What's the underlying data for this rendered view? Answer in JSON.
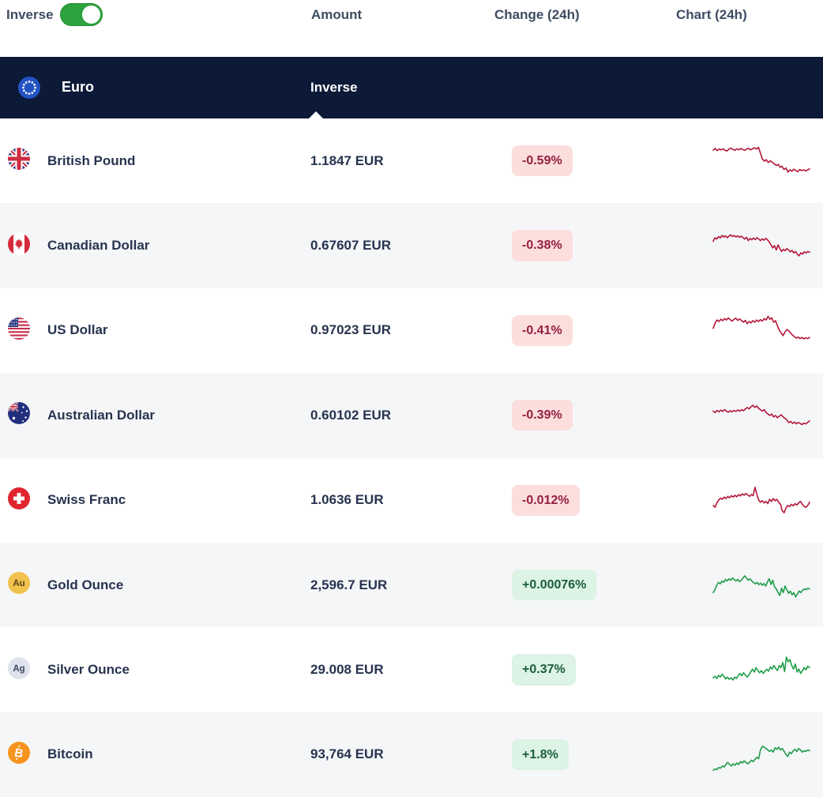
{
  "toolbar": {
    "inverse_label": "Inverse",
    "toggle_on": true,
    "columns": {
      "amount": "Amount",
      "change": "Change (24h)",
      "chart": "Chart (24h)"
    }
  },
  "header": {
    "name": "Euro",
    "inverse_label": "Inverse",
    "flag": "eu"
  },
  "colors": {
    "navy_header": "#0c1a38",
    "toggle_green": "#2da23e",
    "row_alt": "#f5f6f8",
    "badge_down_bg": "#fcdedd",
    "badge_down_text": "#94203f",
    "badge_up_bg": "#dcf3e6",
    "badge_up_text": "#1b5e3a",
    "spark_down": "#b3173a",
    "spark_up": "#1f9d48"
  },
  "table": {
    "rows": [
      {
        "name": "British Pound",
        "flag": "gb",
        "amount": "1.1847 EUR",
        "change": "-0.59%",
        "direction": "down",
        "sparkline": [
          0.8,
          0.85,
          0.79,
          0.83,
          0.81,
          0.84,
          0.8,
          0.78,
          0.83,
          0.86,
          0.82,
          0.8,
          0.84,
          0.81,
          0.85,
          0.82,
          0.8,
          0.83,
          0.85,
          0.81,
          0.84,
          0.87,
          0.83,
          0.88,
          0.72,
          0.56,
          0.5,
          0.54,
          0.46,
          0.51,
          0.47,
          0.43,
          0.38,
          0.41,
          0.33,
          0.36,
          0.27,
          0.31,
          0.2,
          0.26,
          0.22,
          0.28,
          0.24,
          0.21,
          0.27,
          0.24,
          0.26,
          0.23,
          0.26,
          0.29
        ]
      },
      {
        "name": "Canadian Dollar",
        "flag": "ca",
        "amount": "0.67607 EUR",
        "change": "-0.38%",
        "direction": "down",
        "sparkline": [
          0.62,
          0.72,
          0.68,
          0.75,
          0.71,
          0.78,
          0.74,
          0.77,
          0.72,
          0.76,
          0.8,
          0.75,
          0.78,
          0.74,
          0.77,
          0.73,
          0.76,
          0.72,
          0.68,
          0.73,
          0.64,
          0.7,
          0.66,
          0.71,
          0.67,
          0.72,
          0.68,
          0.64,
          0.69,
          0.65,
          0.7,
          0.66,
          0.6,
          0.52,
          0.44,
          0.5,
          0.38,
          0.52,
          0.42,
          0.34,
          0.4,
          0.36,
          0.42,
          0.38,
          0.33,
          0.37,
          0.3,
          0.34,
          0.26,
          0.22,
          0.3,
          0.27,
          0.33,
          0.3,
          0.34,
          0.32
        ]
      },
      {
        "name": "US Dollar",
        "flag": "us",
        "amount": "0.97023 EUR",
        "change": "-0.41%",
        "direction": "down",
        "sparkline": [
          0.55,
          0.7,
          0.78,
          0.74,
          0.8,
          0.76,
          0.82,
          0.78,
          0.84,
          0.79,
          0.75,
          0.8,
          0.83,
          0.77,
          0.81,
          0.76,
          0.72,
          0.77,
          0.68,
          0.74,
          0.7,
          0.76,
          0.72,
          0.78,
          0.74,
          0.79,
          0.75,
          0.82,
          0.78,
          0.88,
          0.8,
          0.84,
          0.72,
          0.76,
          0.62,
          0.5,
          0.42,
          0.35,
          0.45,
          0.52,
          0.48,
          0.42,
          0.36,
          0.32,
          0.28,
          0.31,
          0.27,
          0.3,
          0.26,
          0.29,
          0.27,
          0.3
        ]
      },
      {
        "name": "Australian Dollar",
        "flag": "au",
        "amount": "0.60102 EUR",
        "change": "-0.39%",
        "direction": "down",
        "sparkline": [
          0.62,
          0.58,
          0.64,
          0.6,
          0.65,
          0.61,
          0.66,
          0.62,
          0.59,
          0.63,
          0.6,
          0.64,
          0.61,
          0.65,
          0.62,
          0.66,
          0.63,
          0.68,
          0.72,
          0.68,
          0.74,
          0.78,
          0.72,
          0.76,
          0.7,
          0.66,
          0.62,
          0.66,
          0.58,
          0.54,
          0.5,
          0.54,
          0.46,
          0.5,
          0.44,
          0.48,
          0.52,
          0.46,
          0.42,
          0.38,
          0.3,
          0.34,
          0.28,
          0.32,
          0.27,
          0.31,
          0.28,
          0.25,
          0.29,
          0.27,
          0.31,
          0.35
        ]
      },
      {
        "name": "Swiss Franc",
        "flag": "ch",
        "amount": "1.0636 EUR",
        "change": "-0.012%",
        "direction": "down",
        "sparkline": [
          0.35,
          0.3,
          0.42,
          0.5,
          0.55,
          0.52,
          0.58,
          0.54,
          0.6,
          0.56,
          0.62,
          0.58,
          0.63,
          0.59,
          0.65,
          0.61,
          0.67,
          0.63,
          0.68,
          0.64,
          0.6,
          0.65,
          0.62,
          0.85,
          0.66,
          0.5,
          0.44,
          0.48,
          0.42,
          0.46,
          0.4,
          0.52,
          0.46,
          0.54,
          0.48,
          0.52,
          0.44,
          0.38,
          0.2,
          0.15,
          0.28,
          0.35,
          0.32,
          0.38,
          0.34,
          0.4,
          0.36,
          0.42,
          0.46,
          0.38,
          0.32,
          0.3,
          0.35,
          0.44
        ]
      },
      {
        "name": "Gold Ounce",
        "flag": "gold",
        "amount": "2,596.7 EUR",
        "change": "+0.00076%",
        "direction": "up",
        "sparkline": [
          0.3,
          0.38,
          0.5,
          0.58,
          0.54,
          0.62,
          0.58,
          0.66,
          0.62,
          0.68,
          0.64,
          0.7,
          0.66,
          0.62,
          0.66,
          0.6,
          0.64,
          0.7,
          0.76,
          0.7,
          0.64,
          0.68,
          0.62,
          0.58,
          0.54,
          0.58,
          0.52,
          0.56,
          0.5,
          0.55,
          0.48,
          0.6,
          0.68,
          0.52,
          0.64,
          0.46,
          0.4,
          0.3,
          0.22,
          0.42,
          0.3,
          0.48,
          0.38,
          0.28,
          0.34,
          0.24,
          0.3,
          0.18,
          0.26,
          0.34,
          0.3,
          0.36,
          0.4,
          0.38,
          0.42,
          0.4
        ]
      },
      {
        "name": "Silver Ounce",
        "flag": "silver",
        "amount": "29.008 EUR",
        "change": "+0.37%",
        "direction": "up",
        "sparkline": [
          0.28,
          0.32,
          0.26,
          0.35,
          0.3,
          0.38,
          0.32,
          0.25,
          0.3,
          0.24,
          0.28,
          0.22,
          0.3,
          0.26,
          0.34,
          0.4,
          0.34,
          0.42,
          0.36,
          0.3,
          0.36,
          0.44,
          0.52,
          0.44,
          0.56,
          0.48,
          0.42,
          0.48,
          0.4,
          0.46,
          0.52,
          0.46,
          0.58,
          0.52,
          0.62,
          0.54,
          0.48,
          0.62,
          0.56,
          0.7,
          0.45,
          0.85,
          0.72,
          0.78,
          0.62,
          0.52,
          0.66,
          0.44,
          0.52,
          0.4,
          0.48,
          0.56,
          0.5,
          0.6,
          0.56
        ]
      },
      {
        "name": "Bitcoin",
        "flag": "btc",
        "amount": "93,764 EUR",
        "change": "+1.8%",
        "direction": "up",
        "sparkline": [
          0.06,
          0.1,
          0.08,
          0.14,
          0.12,
          0.18,
          0.15,
          0.22,
          0.28,
          0.22,
          0.18,
          0.24,
          0.2,
          0.26,
          0.22,
          0.3,
          0.26,
          0.32,
          0.28,
          0.24,
          0.28,
          0.34,
          0.3,
          0.36,
          0.42,
          0.38,
          0.62,
          0.72,
          0.7,
          0.66,
          0.62,
          0.58,
          0.62,
          0.56,
          0.68,
          0.64,
          0.7,
          0.62,
          0.66,
          0.58,
          0.5,
          0.44,
          0.56,
          0.52,
          0.6,
          0.64,
          0.58,
          0.66,
          0.62,
          0.56,
          0.6,
          0.58,
          0.62,
          0.6
        ]
      }
    ]
  }
}
